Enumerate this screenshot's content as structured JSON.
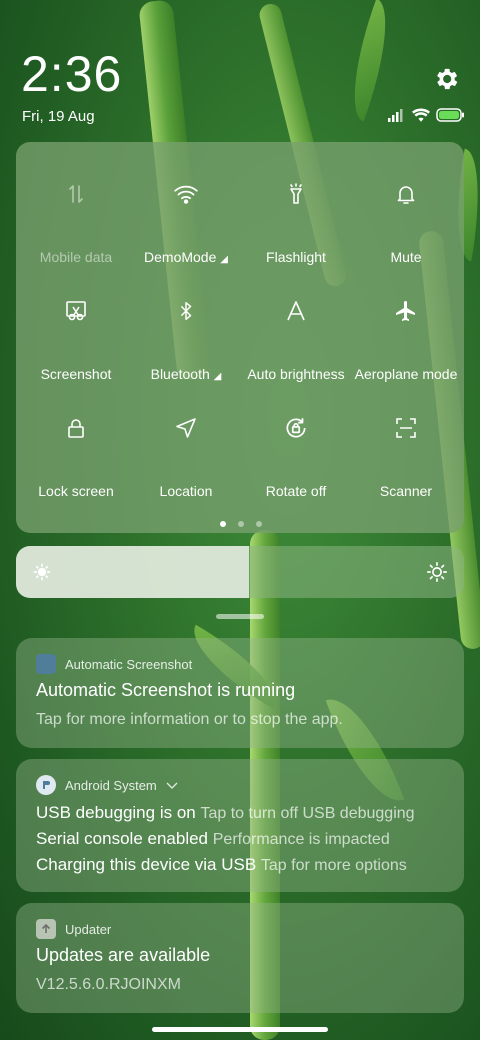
{
  "status": {
    "time": "2:36",
    "date": "Fri, 19 Aug"
  },
  "quick_settings": {
    "tiles": [
      {
        "label": "Mobile data",
        "icon": "mobile-data-icon",
        "enabled": false
      },
      {
        "label": "DemoMode",
        "icon": "wifi-icon",
        "enabled": true,
        "expandable": true
      },
      {
        "label": "Flashlight",
        "icon": "flashlight-icon",
        "enabled": true
      },
      {
        "label": "Mute",
        "icon": "bell-icon",
        "enabled": true
      },
      {
        "label": "Screenshot",
        "icon": "screenshot-icon",
        "enabled": true
      },
      {
        "label": "Bluetooth",
        "icon": "bluetooth-icon",
        "enabled": true,
        "expandable": true
      },
      {
        "label": "Auto brightness",
        "icon": "auto-brightness-icon",
        "enabled": true
      },
      {
        "label": "Aeroplane mode",
        "icon": "airplane-icon",
        "enabled": true
      },
      {
        "label": "Lock screen",
        "icon": "lock-icon",
        "enabled": true
      },
      {
        "label": "Location",
        "icon": "location-icon",
        "enabled": true
      },
      {
        "label": "Rotate off",
        "icon": "rotate-icon",
        "enabled": true
      },
      {
        "label": "Scanner",
        "icon": "scanner-icon",
        "enabled": true
      }
    ],
    "page_count": 3,
    "current_page": 1
  },
  "brightness": {
    "level": 0.52
  },
  "notifications": [
    {
      "app": "Automatic Screenshot",
      "title": "Automatic Screenshot is running",
      "text": "Tap for more information or to stop the app."
    },
    {
      "app": "Android System",
      "lines": [
        {
          "title": "USB debugging is on",
          "text": "Tap to turn off USB debugging"
        },
        {
          "title": "Serial console enabled",
          "text": "Performance is impacted"
        },
        {
          "title": "Charging this device via USB",
          "text": "Tap for more options"
        }
      ]
    },
    {
      "app": "Updater",
      "title": "Updates are available",
      "text": "V12.5.6.0.RJOINXM"
    }
  ],
  "colors": {
    "wallpaper": "#2c6e2a",
    "panel": "#78a06e",
    "notif_icon_blue": "#4f7d9a"
  }
}
